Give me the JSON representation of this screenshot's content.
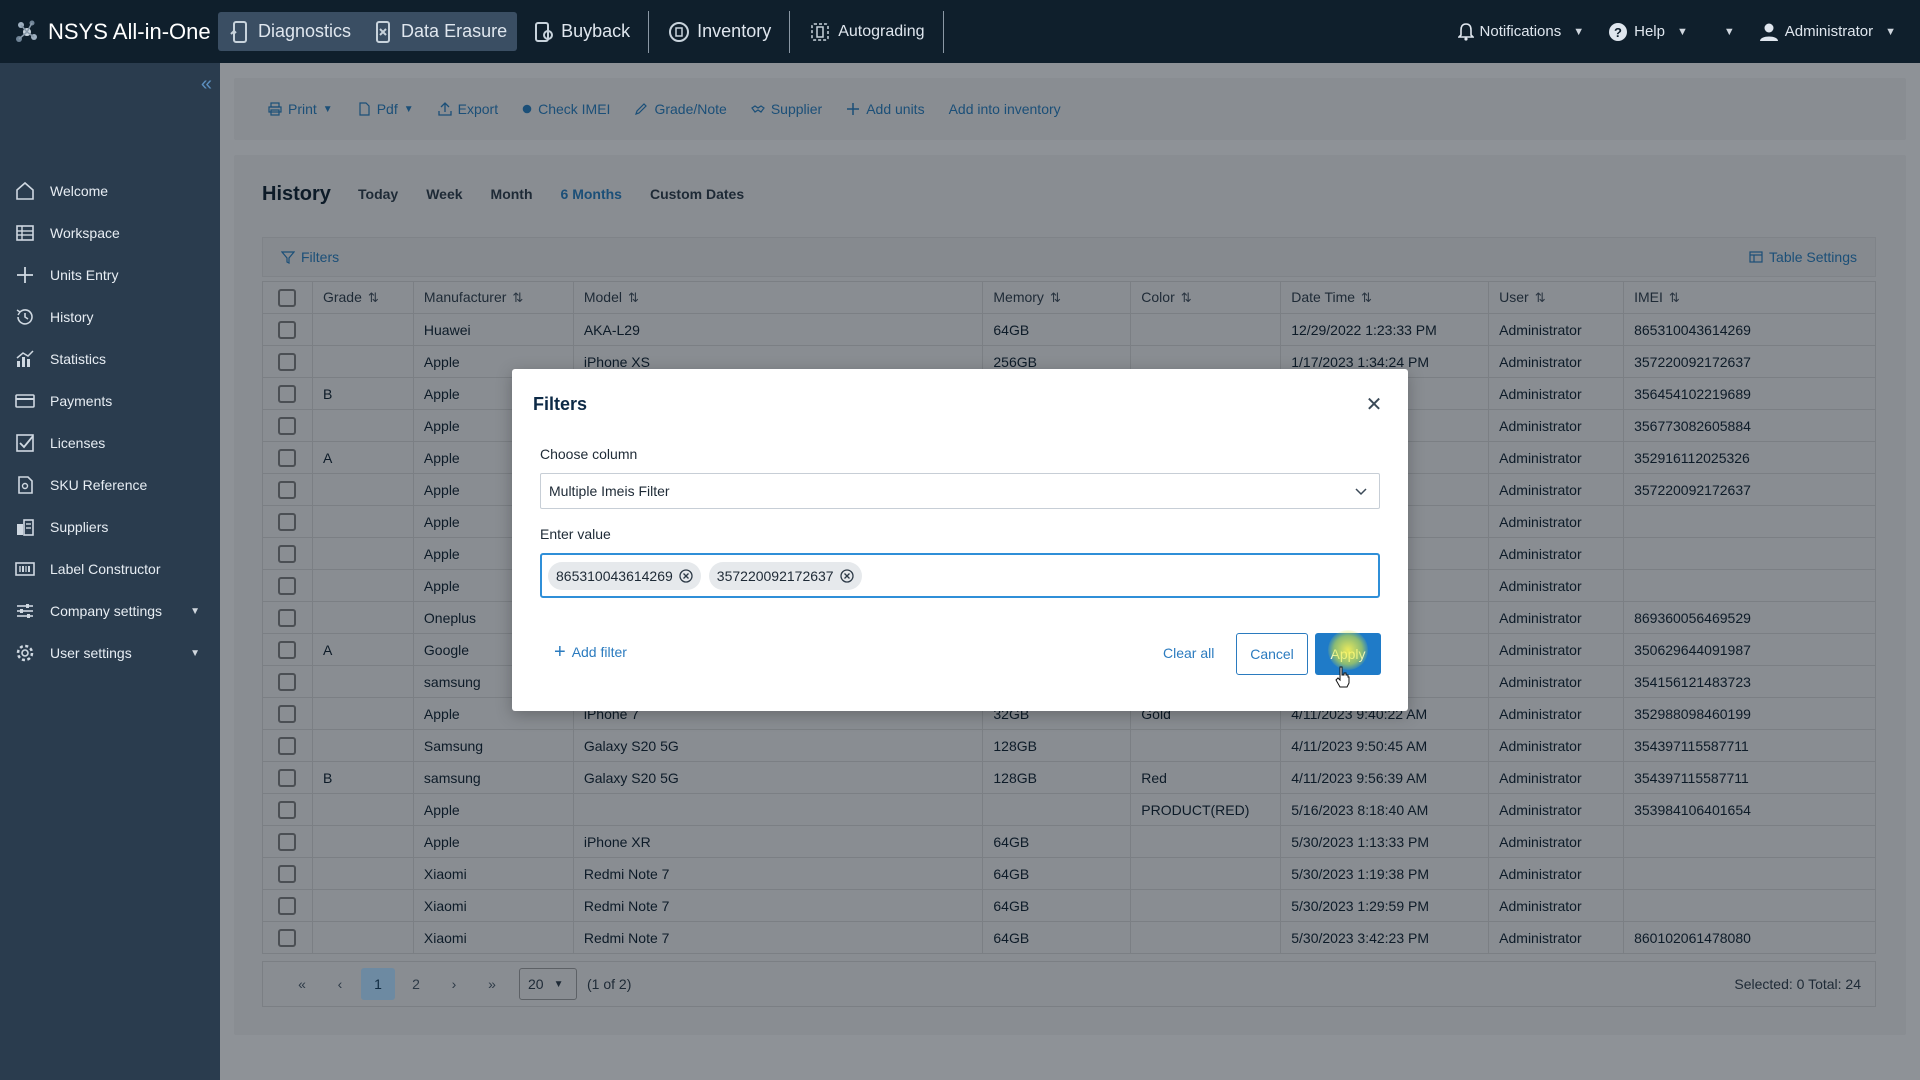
{
  "app": {
    "title": "NSYS All-in-One"
  },
  "topnav": {
    "items": [
      {
        "label": "Diagnostics",
        "icon": "diagnostics-icon"
      },
      {
        "label": "Data Erasure",
        "icon": "data-erasure-icon"
      },
      {
        "label": "Buyback",
        "icon": "buyback-icon"
      },
      {
        "label": "Inventory",
        "icon": "inventory-icon"
      },
      {
        "label": "Autograding",
        "icon": "autograding-icon"
      }
    ],
    "notifications": "Notifications",
    "help": "Help",
    "user": "Administrator"
  },
  "sidebar": {
    "items": [
      {
        "label": "Welcome"
      },
      {
        "label": "Workspace"
      },
      {
        "label": "Units Entry"
      },
      {
        "label": "History"
      },
      {
        "label": "Statistics"
      },
      {
        "label": "Payments"
      },
      {
        "label": "Licenses"
      },
      {
        "label": "SKU Reference"
      },
      {
        "label": "Suppliers"
      },
      {
        "label": "Label Constructor"
      },
      {
        "label": "Company settings"
      },
      {
        "label": "User settings"
      }
    ]
  },
  "toolbar": {
    "print": "Print",
    "pdf": "Pdf",
    "export": "Export",
    "check_imei": "Check IMEI",
    "grade_note": "Grade/Note",
    "supplier": "Supplier",
    "add_units": "Add units",
    "add_inventory": "Add into inventory"
  },
  "history": {
    "title": "History",
    "ranges": [
      "Today",
      "Week",
      "Month",
      "6 Months",
      "Custom Dates"
    ],
    "active_range": "6 Months",
    "filters_label": "Filters",
    "table_settings": "Table Settings"
  },
  "table": {
    "columns": [
      "Grade",
      "Manufacturer",
      "Model",
      "Memory",
      "Color",
      "Date Time",
      "User",
      "IMEI"
    ],
    "rows": [
      [
        "",
        "Huawei",
        "AKA-L29",
        "64GB",
        "",
        "12/29/2022 1:23:33 PM",
        "Administrator",
        "865310043614269"
      ],
      [
        "",
        "Apple",
        "iPhone XS",
        "256GB",
        "",
        "1/17/2023 1:34:24 PM",
        "Administrator",
        "357220092172637"
      ],
      [
        "B",
        "Apple",
        "",
        "",
        "",
        "AM",
        "Administrator",
        "356454102219689"
      ],
      [
        "",
        "Apple",
        "",
        "",
        "",
        "2 PM",
        "Administrator",
        "356773082605884"
      ],
      [
        "A",
        "Apple",
        "",
        "",
        "",
        "8 PM",
        "Administrator",
        "352916112025326"
      ],
      [
        "",
        "Apple",
        "",
        "",
        "",
        "1 AM",
        "Administrator",
        "357220092172637"
      ],
      [
        "",
        "Apple",
        "",
        "",
        "",
        "PM",
        "Administrator",
        ""
      ],
      [
        "",
        "Apple",
        "",
        "",
        "",
        "PM",
        "Administrator",
        ""
      ],
      [
        "",
        "Apple",
        "",
        "",
        "",
        "PM",
        "Administrator",
        ""
      ],
      [
        "",
        "Oneplus",
        "",
        "",
        "",
        "PM",
        "Administrator",
        "869360056469529"
      ],
      [
        "A",
        "Google",
        "",
        "",
        "",
        "AM",
        "Administrator",
        "350629644091987"
      ],
      [
        "",
        "samsung",
        "",
        "",
        "",
        "AM",
        "Administrator",
        "354156121483723"
      ],
      [
        "",
        "Apple",
        "iPhone 7",
        "32GB",
        "Gold",
        "4/11/2023 9:40:22 AM",
        "Administrator",
        "352988098460199"
      ],
      [
        "",
        "Samsung",
        "Galaxy S20 5G",
        "128GB",
        "",
        "4/11/2023 9:50:45 AM",
        "Administrator",
        "354397115587711"
      ],
      [
        "B",
        "samsung",
        "Galaxy S20 5G",
        "128GB",
        "Red",
        "4/11/2023 9:56:39 AM",
        "Administrator",
        "354397115587711"
      ],
      [
        "",
        "Apple",
        "",
        "",
        "PRODUCT(RED)",
        "5/16/2023 8:18:40 AM",
        "Administrator",
        "353984106401654"
      ],
      [
        "",
        "Apple",
        "iPhone XR",
        "64GB",
        "",
        "5/30/2023 1:13:33 PM",
        "Administrator",
        ""
      ],
      [
        "",
        "Xiaomi",
        "Redmi Note 7",
        "64GB",
        "",
        "5/30/2023 1:19:38 PM",
        "Administrator",
        ""
      ],
      [
        "",
        "Xiaomi",
        "Redmi Note 7",
        "64GB",
        "",
        "5/30/2023 1:29:59 PM",
        "Administrator",
        ""
      ],
      [
        "",
        "Xiaomi",
        "Redmi Note 7",
        "64GB",
        "",
        "5/30/2023 3:42:23 PM",
        "Administrator",
        "860102061478080"
      ]
    ]
  },
  "pager": {
    "pages": [
      "1",
      "2"
    ],
    "current": "1",
    "page_size": "20",
    "info": "(1 of 2)",
    "summary": "Selected: 0  Total: 24"
  },
  "modal": {
    "title": "Filters",
    "choose_column_label": "Choose column",
    "selected_column": "Multiple Imeis Filter",
    "enter_value_label": "Enter value",
    "chips": [
      "865310043614269",
      "357220092172637"
    ],
    "add_filter": "Add filter",
    "clear_all": "Clear all",
    "cancel": "Cancel",
    "apply": "Apply"
  }
}
